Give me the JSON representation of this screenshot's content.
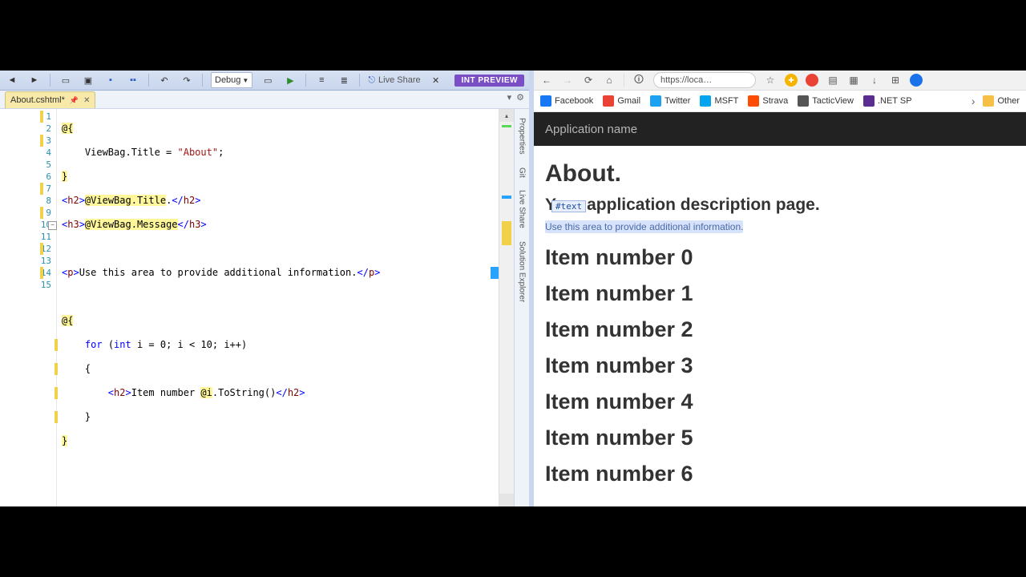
{
  "vs": {
    "toolbar": {
      "config": "Debug",
      "live_share": "Live Share",
      "int_preview": "INT PREVIEW"
    },
    "tab": {
      "filename": "About.cshtml*"
    },
    "side_labels": [
      "Properties",
      "Git",
      "Live Share",
      "Solution Explorer"
    ],
    "lines": [
      "1",
      "2",
      "3",
      "4",
      "5",
      "6",
      "7",
      "8",
      "9",
      "10",
      "11",
      "12",
      "13",
      "14",
      "15"
    ],
    "code": {
      "l1": "@{",
      "l2a": "    ViewBag.Title = ",
      "l2b": "\"About\"",
      "l2c": ";",
      "l3": "}",
      "l4": "<h2>@ViewBag.Title.</h2>",
      "l5": "<h3>@ViewBag.Message</h3>",
      "l7": "<p>Use this area to provide additional information.</p>",
      "l9": "@{",
      "l10a": "    for",
      "l10b": " (",
      "l10c": "int",
      "l10d": " i = 0; i < 10; i++)",
      "l11": "    {",
      "l12a": "        <h2>Item number ",
      "l12b": "@i",
      "l12c": ".ToString()",
      "l12d": "</h2>",
      "l13": "    }",
      "l14": "}"
    }
  },
  "browser": {
    "url": "https://loca…",
    "bookmarks": [
      {
        "label": "Facebook",
        "color": "#1877f2"
      },
      {
        "label": "Gmail",
        "color": "#ea4335"
      },
      {
        "label": "Twitter",
        "color": "#1da1f2"
      },
      {
        "label": "MSFT",
        "color": "#00a4ef"
      },
      {
        "label": "Strava",
        "color": "#fc4c02"
      },
      {
        "label": "TacticView",
        "color": "#555"
      },
      {
        "label": ".NET SP",
        "color": "#5c2d91"
      }
    ],
    "other": "Other",
    "page": {
      "brand": "Application name",
      "title": "About.",
      "subtitle": "Your application description page.",
      "inspector": "#text",
      "para": "Use this area to provide additional information.",
      "items": [
        "Item number 0",
        "Item number 1",
        "Item number 2",
        "Item number 3",
        "Item number 4",
        "Item number 5",
        "Item number 6"
      ]
    }
  }
}
